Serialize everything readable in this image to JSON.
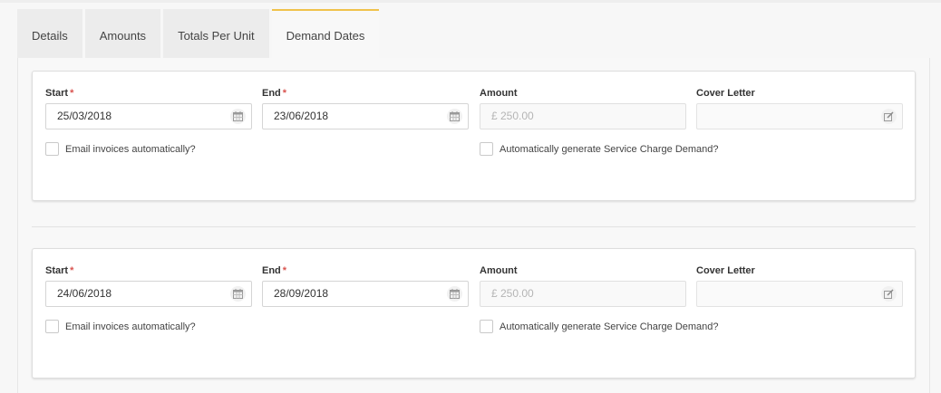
{
  "tabs": [
    {
      "label": "Details"
    },
    {
      "label": "Amounts"
    },
    {
      "label": "Totals Per Unit"
    },
    {
      "label": "Demand Dates",
      "active": true
    }
  ],
  "labels": {
    "start": "Start",
    "end": "End",
    "amount": "Amount",
    "cover_letter": "Cover Letter",
    "required_mark": "*",
    "email_checkbox": "Email invoices automatically?",
    "generate_checkbox": "Automatically generate Service Charge Demand?"
  },
  "demands": [
    {
      "start": "25/03/2018",
      "end": "23/06/2018",
      "amount": "£ 250.00",
      "cover_letter": "",
      "email_auto": false,
      "generate_auto": false
    },
    {
      "start": "24/06/2018",
      "end": "28/09/2018",
      "amount": "£ 250.00",
      "cover_letter": "",
      "email_auto": false,
      "generate_auto": false
    }
  ],
  "colors": {
    "active_tab_accent": "#f0c24b",
    "required_mark": "#d9534f"
  },
  "icons": {
    "date_picker": "calendar-icon",
    "cover_letter": "edit-icon"
  }
}
